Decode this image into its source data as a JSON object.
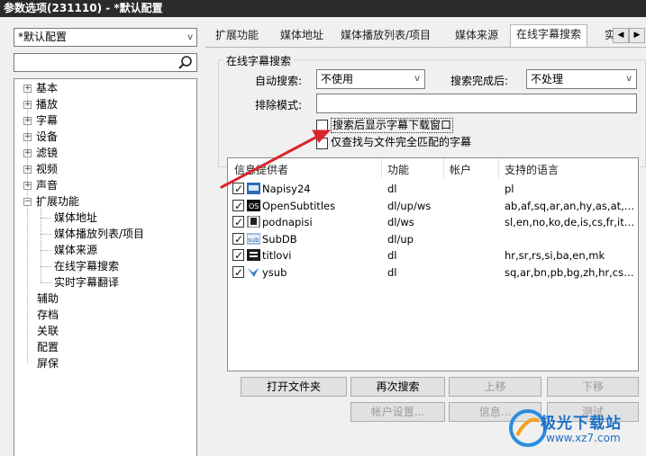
{
  "window": {
    "title": "参数选项(231110) - *默认配置"
  },
  "left": {
    "profile": "*默认配置",
    "search_placeholder": "",
    "tree": [
      {
        "label": "基本",
        "expandable": true
      },
      {
        "label": "播放",
        "expandable": true
      },
      {
        "label": "字幕",
        "expandable": true
      },
      {
        "label": "设备",
        "expandable": true
      },
      {
        "label": "滤镜",
        "expandable": true
      },
      {
        "label": "视频",
        "expandable": true
      },
      {
        "label": "声音",
        "expandable": true
      },
      {
        "label": "扩展功能",
        "expandable": true,
        "expanded": true,
        "children": [
          "媒体地址",
          "媒体播放列表/项目",
          "媒体来源",
          "在线字幕搜索",
          "实时字幕翻译"
        ]
      },
      {
        "label": "辅助"
      },
      {
        "label": "存档"
      },
      {
        "label": "关联"
      },
      {
        "label": "配置"
      },
      {
        "label": "屏保"
      }
    ]
  },
  "tabs": [
    "扩展功能",
    "媒体地址",
    "媒体播放列表/项目",
    "媒体来源",
    "在线字幕搜索",
    "实时"
  ],
  "active_tab": "在线字幕搜索",
  "section": {
    "title": "在线字幕搜索",
    "auto_search_label": "自动搜索:",
    "auto_search_value": "不使用",
    "after_search_label": "搜索完成后:",
    "after_search_value": "不处理",
    "exclude_label": "排除模式:",
    "exclude_value": "",
    "opt_show_window": {
      "label": "搜索后显示字幕下载窗口",
      "checked": false
    },
    "opt_exact_match": {
      "label": "仅查找与文件完全匹配的字幕",
      "checked": false
    }
  },
  "providers": {
    "headers": [
      "信息提供者",
      "功能",
      "帐户",
      "支持的语言"
    ],
    "rows": [
      {
        "name": "Napisy24",
        "func": "dl",
        "account": "",
        "langs": "pl",
        "checked": true,
        "icon": "napisy24-icon"
      },
      {
        "name": "OpenSubtitles",
        "func": "dl/up/ws",
        "account": "",
        "langs": "ab,af,sq,ar,an,hy,as,at,az...",
        "checked": true,
        "icon": "opensubtitles-icon"
      },
      {
        "name": "podnapisi",
        "func": "dl/ws",
        "account": "",
        "langs": "sl,en,no,ko,de,is,cs,fr,it,b...",
        "checked": true,
        "icon": "podnapisi-icon"
      },
      {
        "name": "SubDB",
        "func": "dl/up",
        "account": "",
        "langs": "",
        "checked": true,
        "icon": "subdb-icon"
      },
      {
        "name": "titlovi",
        "func": "dl",
        "account": "",
        "langs": "hr,sr,rs,si,ba,en,mk",
        "checked": true,
        "icon": "titlovi-icon"
      },
      {
        "name": "ysub",
        "func": "dl",
        "account": "",
        "langs": "sq,ar,bn,pb,bg,zh,hr,cs,d...",
        "checked": true,
        "icon": "ysub-icon"
      }
    ]
  },
  "buttons": {
    "open_folder": "打开文件夹",
    "search_again": "再次搜索",
    "move_up": "上移",
    "move_down": "下移",
    "account_settings": "帐户设置...",
    "info": "信息...",
    "test": "测试"
  },
  "annotation": {
    "color": "#d9262b"
  },
  "watermark": {
    "brand": "极光下载站",
    "url": "www.xz7.com"
  }
}
